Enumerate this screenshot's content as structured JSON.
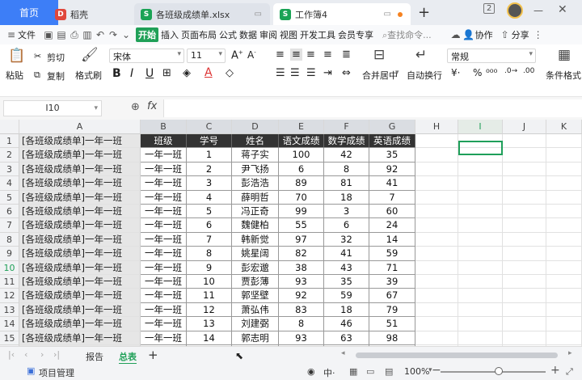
{
  "titlebar": {
    "home_tab": "首页",
    "tabs": [
      {
        "label": "稻壳",
        "icon": "docer-icon"
      },
      {
        "label": "各班级成绩单.xlsx",
        "icon": "et-icon"
      },
      {
        "label": "工作簿4",
        "icon": "et-icon"
      }
    ],
    "window_badge": "2"
  },
  "menubar": {
    "file": "文件",
    "items": [
      "开始",
      "插入",
      "页面布局",
      "公式",
      "数据",
      "审阅",
      "视图",
      "开发工具",
      "会员专享"
    ],
    "search": "查找命令...",
    "collab": "协作",
    "share": "分享"
  },
  "ribbon": {
    "paste": "粘贴",
    "cut": "剪切",
    "copy": "复制",
    "format_painter": "格式刷",
    "font_name": "宋体",
    "font_size": "11",
    "merge": "合并居中",
    "wrap": "自动换行",
    "number_format": "常规",
    "cond_format": "条件格式"
  },
  "formula_bar": {
    "cell_ref": "I10",
    "fx": "fx",
    "value": ""
  },
  "sheet": {
    "columns": [
      "A",
      "B",
      "C",
      "D",
      "E",
      "F",
      "G",
      "H",
      "I",
      "J",
      "K"
    ],
    "active_col": "I",
    "active_row": "10",
    "header": [
      "班级",
      "学号",
      "姓名",
      "语文成绩",
      "数学成绩",
      "英语成绩"
    ],
    "col_a_text": "[各班级成绩单]一年一班",
    "rows": [
      {
        "n": "2",
        "cls": "一年一班",
        "id": "1",
        "name": "蒋子实",
        "chinese": "100",
        "math": "42",
        "english": "35"
      },
      {
        "n": "3",
        "cls": "一年一班",
        "id": "2",
        "name": "尹飞扬",
        "chinese": "6",
        "math": "8",
        "english": "92"
      },
      {
        "n": "4",
        "cls": "一年一班",
        "id": "3",
        "name": "彭浩浩",
        "chinese": "89",
        "math": "81",
        "english": "41"
      },
      {
        "n": "5",
        "cls": "一年一班",
        "id": "4",
        "name": "薛明哲",
        "chinese": "70",
        "math": "18",
        "english": "7"
      },
      {
        "n": "6",
        "cls": "一年一班",
        "id": "5",
        "name": "冯正奇",
        "chinese": "99",
        "math": "3",
        "english": "60"
      },
      {
        "n": "7",
        "cls": "一年一班",
        "id": "6",
        "name": "魏健柏",
        "chinese": "55",
        "math": "6",
        "english": "24"
      },
      {
        "n": "8",
        "cls": "一年一班",
        "id": "7",
        "name": "韩新觉",
        "chinese": "97",
        "math": "32",
        "english": "14"
      },
      {
        "n": "9",
        "cls": "一年一班",
        "id": "8",
        "name": "姚星阔",
        "chinese": "82",
        "math": "41",
        "english": "59"
      },
      {
        "n": "10",
        "cls": "一年一班",
        "id": "9",
        "name": "彭宏邈",
        "chinese": "38",
        "math": "43",
        "english": "71"
      },
      {
        "n": "11",
        "cls": "一年一班",
        "id": "10",
        "name": "贾彭薄",
        "chinese": "93",
        "math": "35",
        "english": "39"
      },
      {
        "n": "12",
        "cls": "一年一班",
        "id": "11",
        "name": "郭坚壁",
        "chinese": "92",
        "math": "59",
        "english": "67"
      },
      {
        "n": "13",
        "cls": "一年一班",
        "id": "12",
        "name": "萧弘伟",
        "chinese": "83",
        "math": "18",
        "english": "79"
      },
      {
        "n": "14",
        "cls": "一年一班",
        "id": "13",
        "name": "刘建弼",
        "chinese": "8",
        "math": "46",
        "english": "51"
      },
      {
        "n": "15",
        "cls": "一年一班",
        "id": "14",
        "name": "郭志明",
        "chinese": "93",
        "math": "63",
        "english": "98"
      }
    ]
  },
  "sheet_tabs": {
    "tabs": [
      "报告",
      "总表"
    ],
    "active": "总表"
  },
  "statusbar": {
    "project": "项目管理",
    "zoom": "100%"
  }
}
